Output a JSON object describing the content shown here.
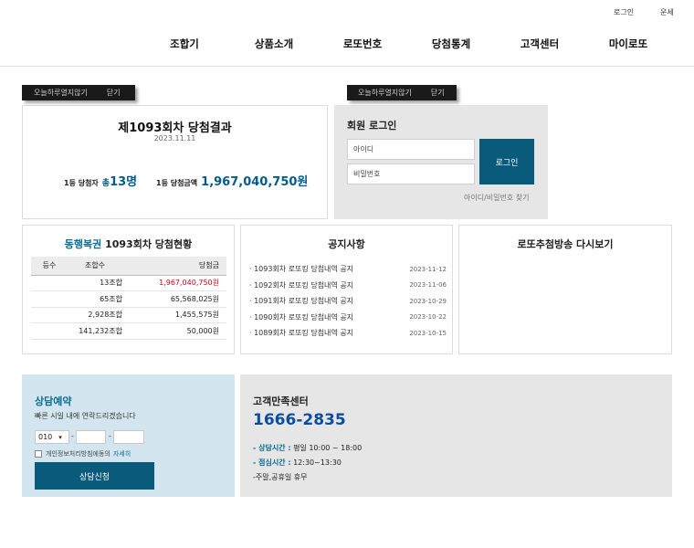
{
  "top_links": {
    "login": "로그인",
    "fortune": "운세"
  },
  "nav": [
    "조합기",
    "상품소개",
    "로또번호",
    "당첨통계",
    "고객센터",
    "마이로또"
  ],
  "popups": [
    {
      "hide_today": "오늘하루열지않기",
      "close": "닫기"
    },
    {
      "hide_today": "오늘하루열지않기",
      "close": "닫기"
    }
  ],
  "result": {
    "title": "제1093회차 당첨결과",
    "date": "2023.11.11",
    "winners_label": "1등 당첨자",
    "winners_prefix": "총",
    "winners_value": "13명",
    "amount_label": "1등 당첨금액",
    "amount_value": "1,967,040,750원"
  },
  "login": {
    "title": "회원 로그인",
    "id_placeholder": "아이디",
    "pw_placeholder": "비밀번호",
    "button": "로그인",
    "find": "아이디/비밀번호 찾기"
  },
  "prize_status": {
    "brand": "동행복권",
    "title": "1093회차 당첨현황",
    "headers": [
      "등수",
      "조합수",
      "당첨금"
    ],
    "rows": [
      {
        "rank": "",
        "count": "13조합",
        "amount": "1,967,040,750원"
      },
      {
        "rank": "",
        "count": "65조합",
        "amount": "65,568,025원"
      },
      {
        "rank": "",
        "count": "2,928조합",
        "amount": "1,455,575원"
      },
      {
        "rank": "",
        "count": "141,232조합",
        "amount": "50,000원"
      }
    ]
  },
  "notices": {
    "title": "공지사항",
    "items": [
      {
        "text": "· 1093회차 로또킹 당첨내역 공지",
        "date": "2023-11-12"
      },
      {
        "text": "· 1092회차 로또킹 당첨내역 공지",
        "date": "2023-11-06"
      },
      {
        "text": "· 1091회차 로또킹 당첨내역 공지",
        "date": "2023-10-29"
      },
      {
        "text": "· 1090회차 로또킹 당첨내역 공지",
        "date": "2023-10-22"
      },
      {
        "text": "· 1089회차 로또킹 당첨내역 공지",
        "date": "2023-10-15"
      }
    ]
  },
  "broadcast": {
    "title": "로또추첨방송 다시보기"
  },
  "consult": {
    "title": "상담예약",
    "subtitle": "빠른 시일 내에 연락드리겠습니다",
    "phone_prefix": "010",
    "dash": "-",
    "agree_text": "개인정보처리방침에동의",
    "agree_detail": "자세히",
    "button": "상담신청"
  },
  "cs": {
    "title": "고객만족센터",
    "phone": "1666-2835",
    "hours_label": "- 상담시간 :",
    "hours_value": " 평일 10:00 ~ 18:00",
    "lunch_label": "- 점심시간 :",
    "lunch_value": " 12:30~13:30",
    "closed": "-주말,공휴일 휴무"
  },
  "colors": {
    "accent": "#0a5a7c",
    "highlight_red": "#d0021b",
    "phone_blue": "#0a4f9e"
  }
}
